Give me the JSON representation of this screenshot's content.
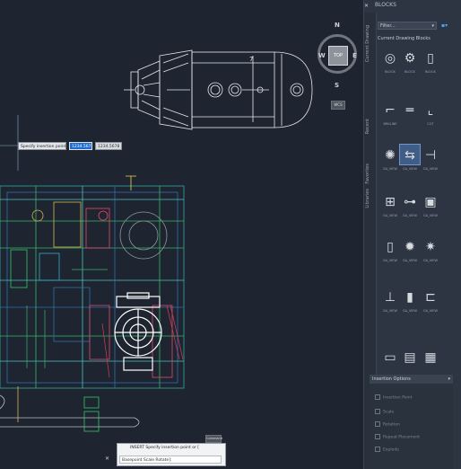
{
  "palette": {
    "title": "BLOCKS",
    "tabs": [
      "Current Drawing",
      "Recent",
      "Favorites",
      "Libraries"
    ],
    "filter_value": "Filter...",
    "section_title": "Current Drawing Blocks",
    "blocks": [
      {
        "label": "BLOCK",
        "icon": "flange-block-icon"
      },
      {
        "label": "BLOCK",
        "icon": "manway-block-icon"
      },
      {
        "label": "BLOCK",
        "icon": "nozzle-block-icon"
      },
      {
        "label": "BRKLINE",
        "icon": "breakline-icon"
      },
      {
        "label": "",
        "icon": "pipe-block-icon"
      },
      {
        "label": "CUT",
        "icon": "cut-symbol-icon"
      },
      {
        "label": "GA_VIEW",
        "icon": "pump-block-icon"
      },
      {
        "label": "GA_VIEW",
        "icon": "valve-block-icon"
      },
      {
        "label": "GA_VIEW",
        "icon": "instrument-block-icon"
      },
      {
        "label": "GA_VIEW",
        "icon": "motor-block-icon"
      },
      {
        "label": "GA_VIEW",
        "icon": "shaft-block-icon"
      },
      {
        "label": "GA_VIEW",
        "icon": "frame-block-icon"
      },
      {
        "label": "GA_VIEW",
        "icon": "column-block-icon"
      },
      {
        "label": "GA_VIEW",
        "icon": "gear-block-icon"
      },
      {
        "label": "GA_VIEW",
        "icon": "wheel-block-icon"
      },
      {
        "label": "GA_VIEW",
        "icon": "post-block-icon"
      },
      {
        "label": "GA_VIEW",
        "icon": "panel-block-icon"
      },
      {
        "label": "GA_VIEW",
        "icon": "bracket-block-icon"
      },
      {
        "label": "",
        "icon": "rect-block-icon"
      },
      {
        "label": "",
        "icon": "grid-block-icon"
      },
      {
        "label": "",
        "icon": "box-block-icon"
      }
    ],
    "selected_index": 7,
    "options": {
      "title": "Insertion Options",
      "items": [
        "Insertion Point",
        "Scale",
        "Rotation",
        "Repeat Placement",
        "Explode"
      ]
    }
  },
  "viewcube": {
    "n": "N",
    "s": "S",
    "e": "E",
    "w": "W",
    "top": "TOP",
    "wcs": "WCS"
  },
  "dynamic_input": {
    "prompt": "Specify insertion point or",
    "value": "1234.5678",
    "value2": "1234.5678"
  },
  "command": {
    "tooltip": "Command",
    "history": "INSERT Specify insertion point or [",
    "input": "Basepoint Scale Rotate]:"
  },
  "colors": {
    "canvas": "#1e2530",
    "accent": "#1b6ed1",
    "panel": "#2d3542"
  }
}
